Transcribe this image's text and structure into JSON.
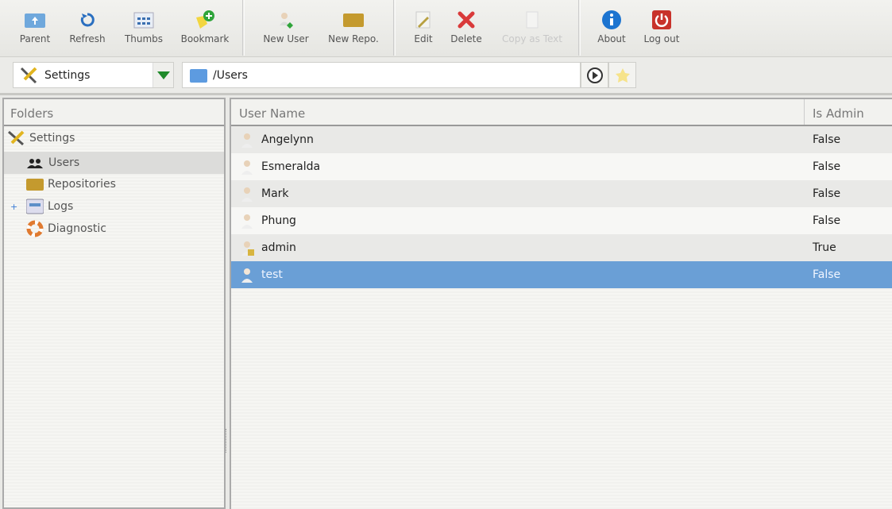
{
  "toolbar": {
    "buttons": [
      {
        "label": "Parent",
        "icon": "folder-up-icon"
      },
      {
        "label": "Refresh",
        "icon": "refresh-icon"
      },
      {
        "label": "Thumbs",
        "icon": "thumbs-icon"
      },
      {
        "label": "Bookmark",
        "icon": "bookmark-add-icon"
      },
      {
        "label": "New User",
        "icon": "new-user-icon"
      },
      {
        "label": "New Repo.",
        "icon": "new-repo-icon"
      },
      {
        "label": "Edit",
        "icon": "edit-icon"
      },
      {
        "label": "Delete",
        "icon": "delete-icon"
      },
      {
        "label": "Copy as Text",
        "icon": "copy-icon"
      },
      {
        "label": "About",
        "icon": "info-icon"
      },
      {
        "label": "Log out",
        "icon": "power-icon"
      }
    ]
  },
  "address": {
    "location": "Settings",
    "path": "/Users"
  },
  "folders": {
    "title": "Folders",
    "items": [
      "Settings",
      "Users",
      "Repositories",
      "Logs",
      "Diagnostic"
    ]
  },
  "table": {
    "headers": [
      "User Name",
      "Is Admin"
    ],
    "rows": [
      [
        "Angelynn",
        "False"
      ],
      [
        "Esmeralda",
        "False"
      ],
      [
        "Mark",
        "False"
      ],
      [
        "Phung",
        "False"
      ],
      [
        "admin",
        "True"
      ],
      [
        "test",
        "False"
      ]
    ],
    "selected": "test"
  },
  "colors": {
    "selection": "#6a9fd6"
  }
}
